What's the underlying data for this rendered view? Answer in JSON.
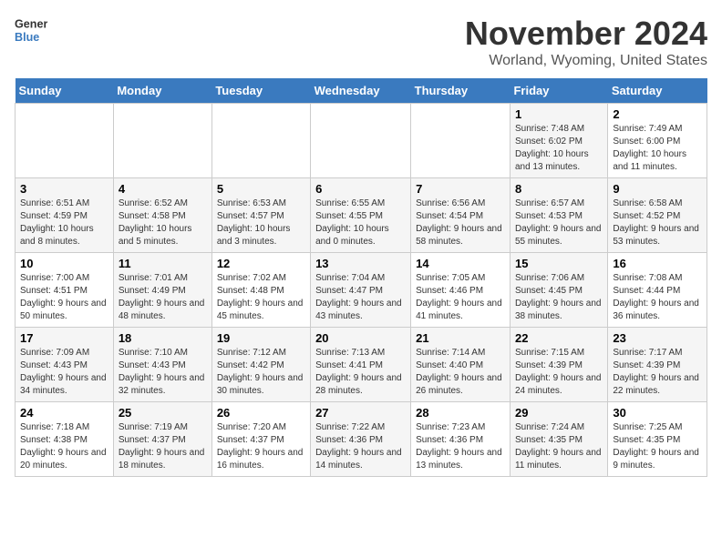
{
  "logo": {
    "line1": "General",
    "line2": "Blue"
  },
  "title": "November 2024",
  "location": "Worland, Wyoming, United States",
  "days_of_week": [
    "Sunday",
    "Monday",
    "Tuesday",
    "Wednesday",
    "Thursday",
    "Friday",
    "Saturday"
  ],
  "weeks": [
    [
      {
        "day": "",
        "info": ""
      },
      {
        "day": "",
        "info": ""
      },
      {
        "day": "",
        "info": ""
      },
      {
        "day": "",
        "info": ""
      },
      {
        "day": "",
        "info": ""
      },
      {
        "day": "1",
        "info": "Sunrise: 7:48 AM\nSunset: 6:02 PM\nDaylight: 10 hours and 13 minutes."
      },
      {
        "day": "2",
        "info": "Sunrise: 7:49 AM\nSunset: 6:00 PM\nDaylight: 10 hours and 11 minutes."
      }
    ],
    [
      {
        "day": "3",
        "info": "Sunrise: 6:51 AM\nSunset: 4:59 PM\nDaylight: 10 hours and 8 minutes."
      },
      {
        "day": "4",
        "info": "Sunrise: 6:52 AM\nSunset: 4:58 PM\nDaylight: 10 hours and 5 minutes."
      },
      {
        "day": "5",
        "info": "Sunrise: 6:53 AM\nSunset: 4:57 PM\nDaylight: 10 hours and 3 minutes."
      },
      {
        "day": "6",
        "info": "Sunrise: 6:55 AM\nSunset: 4:55 PM\nDaylight: 10 hours and 0 minutes."
      },
      {
        "day": "7",
        "info": "Sunrise: 6:56 AM\nSunset: 4:54 PM\nDaylight: 9 hours and 58 minutes."
      },
      {
        "day": "8",
        "info": "Sunrise: 6:57 AM\nSunset: 4:53 PM\nDaylight: 9 hours and 55 minutes."
      },
      {
        "day": "9",
        "info": "Sunrise: 6:58 AM\nSunset: 4:52 PM\nDaylight: 9 hours and 53 minutes."
      }
    ],
    [
      {
        "day": "10",
        "info": "Sunrise: 7:00 AM\nSunset: 4:51 PM\nDaylight: 9 hours and 50 minutes."
      },
      {
        "day": "11",
        "info": "Sunrise: 7:01 AM\nSunset: 4:49 PM\nDaylight: 9 hours and 48 minutes."
      },
      {
        "day": "12",
        "info": "Sunrise: 7:02 AM\nSunset: 4:48 PM\nDaylight: 9 hours and 45 minutes."
      },
      {
        "day": "13",
        "info": "Sunrise: 7:04 AM\nSunset: 4:47 PM\nDaylight: 9 hours and 43 minutes."
      },
      {
        "day": "14",
        "info": "Sunrise: 7:05 AM\nSunset: 4:46 PM\nDaylight: 9 hours and 41 minutes."
      },
      {
        "day": "15",
        "info": "Sunrise: 7:06 AM\nSunset: 4:45 PM\nDaylight: 9 hours and 38 minutes."
      },
      {
        "day": "16",
        "info": "Sunrise: 7:08 AM\nSunset: 4:44 PM\nDaylight: 9 hours and 36 minutes."
      }
    ],
    [
      {
        "day": "17",
        "info": "Sunrise: 7:09 AM\nSunset: 4:43 PM\nDaylight: 9 hours and 34 minutes."
      },
      {
        "day": "18",
        "info": "Sunrise: 7:10 AM\nSunset: 4:43 PM\nDaylight: 9 hours and 32 minutes."
      },
      {
        "day": "19",
        "info": "Sunrise: 7:12 AM\nSunset: 4:42 PM\nDaylight: 9 hours and 30 minutes."
      },
      {
        "day": "20",
        "info": "Sunrise: 7:13 AM\nSunset: 4:41 PM\nDaylight: 9 hours and 28 minutes."
      },
      {
        "day": "21",
        "info": "Sunrise: 7:14 AM\nSunset: 4:40 PM\nDaylight: 9 hours and 26 minutes."
      },
      {
        "day": "22",
        "info": "Sunrise: 7:15 AM\nSunset: 4:39 PM\nDaylight: 9 hours and 24 minutes."
      },
      {
        "day": "23",
        "info": "Sunrise: 7:17 AM\nSunset: 4:39 PM\nDaylight: 9 hours and 22 minutes."
      }
    ],
    [
      {
        "day": "24",
        "info": "Sunrise: 7:18 AM\nSunset: 4:38 PM\nDaylight: 9 hours and 20 minutes."
      },
      {
        "day": "25",
        "info": "Sunrise: 7:19 AM\nSunset: 4:37 PM\nDaylight: 9 hours and 18 minutes."
      },
      {
        "day": "26",
        "info": "Sunrise: 7:20 AM\nSunset: 4:37 PM\nDaylight: 9 hours and 16 minutes."
      },
      {
        "day": "27",
        "info": "Sunrise: 7:22 AM\nSunset: 4:36 PM\nDaylight: 9 hours and 14 minutes."
      },
      {
        "day": "28",
        "info": "Sunrise: 7:23 AM\nSunset: 4:36 PM\nDaylight: 9 hours and 13 minutes."
      },
      {
        "day": "29",
        "info": "Sunrise: 7:24 AM\nSunset: 4:35 PM\nDaylight: 9 hours and 11 minutes."
      },
      {
        "day": "30",
        "info": "Sunrise: 7:25 AM\nSunset: 4:35 PM\nDaylight: 9 hours and 9 minutes."
      }
    ]
  ]
}
